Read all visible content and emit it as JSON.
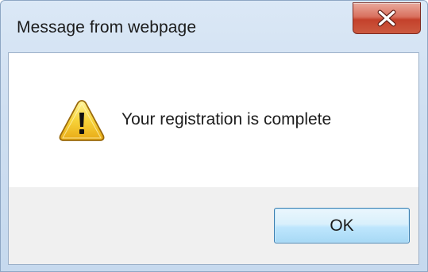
{
  "dialog": {
    "title": "Message from webpage",
    "message": "Your registration is complete",
    "icon": "warning-icon",
    "ok_label": "OK",
    "close_icon": "close-icon"
  },
  "colors": {
    "title_bar": "#cfdff1",
    "close_button": "#c4412b",
    "ok_button": "#bee6fd",
    "button_area": "#f0f0f0"
  }
}
